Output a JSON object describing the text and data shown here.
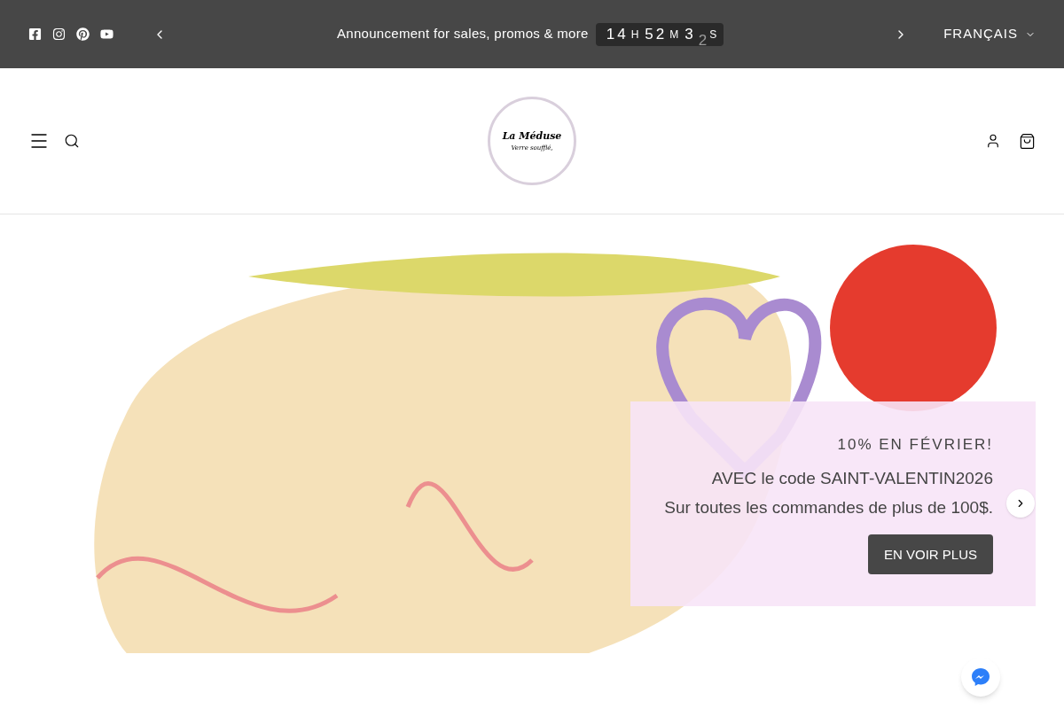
{
  "announcement_bar": {
    "social_links": [
      {
        "kind": "facebook"
      },
      {
        "kind": "instagram"
      },
      {
        "kind": "pinterest"
      },
      {
        "kind": "youtube"
      }
    ],
    "message": "Announcement for sales, promos & more",
    "countdown": [
      {
        "value": "14",
        "unit": "H"
      },
      {
        "value": "52",
        "unit": "M"
      },
      {
        "value": "3",
        "rolling": "2",
        "unit": "S"
      }
    ],
    "language": "FRANÇAIS"
  },
  "header": {
    "logo": {
      "title": "La Méduse",
      "subtitle": "Verre soufflé,"
    }
  },
  "slide": {
    "eyebrow": "10% EN FÉVRIER!",
    "lines": [
      "AVEC le code SAINT-VALENTIN2026",
      "Sur toutes les commandes de plus de 100$."
    ],
    "button": "EN VOIR PLUS"
  }
}
